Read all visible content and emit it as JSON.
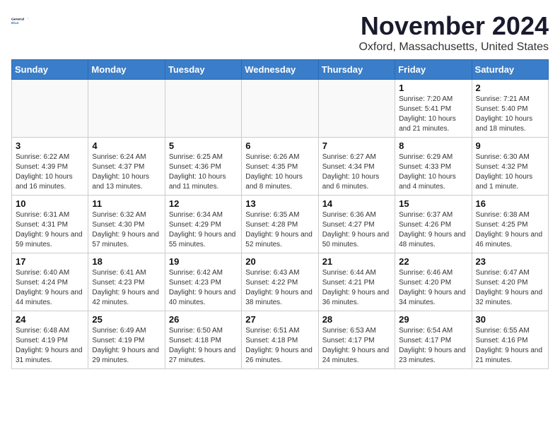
{
  "header": {
    "logo_line1": "General",
    "logo_line2": "Blue",
    "title": "November 2024",
    "subtitle": "Oxford, Massachusetts, United States"
  },
  "weekdays": [
    "Sunday",
    "Monday",
    "Tuesday",
    "Wednesday",
    "Thursday",
    "Friday",
    "Saturday"
  ],
  "weeks": [
    [
      {
        "day": "",
        "empty": true
      },
      {
        "day": "",
        "empty": true
      },
      {
        "day": "",
        "empty": true
      },
      {
        "day": "",
        "empty": true
      },
      {
        "day": "",
        "empty": true
      },
      {
        "day": "1",
        "sunrise": "Sunrise: 7:20 AM",
        "sunset": "Sunset: 5:41 PM",
        "daylight": "Daylight: 10 hours and 21 minutes."
      },
      {
        "day": "2",
        "sunrise": "Sunrise: 7:21 AM",
        "sunset": "Sunset: 5:40 PM",
        "daylight": "Daylight: 10 hours and 18 minutes."
      }
    ],
    [
      {
        "day": "3",
        "sunrise": "Sunrise: 6:22 AM",
        "sunset": "Sunset: 4:39 PM",
        "daylight": "Daylight: 10 hours and 16 minutes."
      },
      {
        "day": "4",
        "sunrise": "Sunrise: 6:24 AM",
        "sunset": "Sunset: 4:37 PM",
        "daylight": "Daylight: 10 hours and 13 minutes."
      },
      {
        "day": "5",
        "sunrise": "Sunrise: 6:25 AM",
        "sunset": "Sunset: 4:36 PM",
        "daylight": "Daylight: 10 hours and 11 minutes."
      },
      {
        "day": "6",
        "sunrise": "Sunrise: 6:26 AM",
        "sunset": "Sunset: 4:35 PM",
        "daylight": "Daylight: 10 hours and 8 minutes."
      },
      {
        "day": "7",
        "sunrise": "Sunrise: 6:27 AM",
        "sunset": "Sunset: 4:34 PM",
        "daylight": "Daylight: 10 hours and 6 minutes."
      },
      {
        "day": "8",
        "sunrise": "Sunrise: 6:29 AM",
        "sunset": "Sunset: 4:33 PM",
        "daylight": "Daylight: 10 hours and 4 minutes."
      },
      {
        "day": "9",
        "sunrise": "Sunrise: 6:30 AM",
        "sunset": "Sunset: 4:32 PM",
        "daylight": "Daylight: 10 hours and 1 minute."
      }
    ],
    [
      {
        "day": "10",
        "sunrise": "Sunrise: 6:31 AM",
        "sunset": "Sunset: 4:31 PM",
        "daylight": "Daylight: 9 hours and 59 minutes."
      },
      {
        "day": "11",
        "sunrise": "Sunrise: 6:32 AM",
        "sunset": "Sunset: 4:30 PM",
        "daylight": "Daylight: 9 hours and 57 minutes."
      },
      {
        "day": "12",
        "sunrise": "Sunrise: 6:34 AM",
        "sunset": "Sunset: 4:29 PM",
        "daylight": "Daylight: 9 hours and 55 minutes."
      },
      {
        "day": "13",
        "sunrise": "Sunrise: 6:35 AM",
        "sunset": "Sunset: 4:28 PM",
        "daylight": "Daylight: 9 hours and 52 minutes."
      },
      {
        "day": "14",
        "sunrise": "Sunrise: 6:36 AM",
        "sunset": "Sunset: 4:27 PM",
        "daylight": "Daylight: 9 hours and 50 minutes."
      },
      {
        "day": "15",
        "sunrise": "Sunrise: 6:37 AM",
        "sunset": "Sunset: 4:26 PM",
        "daylight": "Daylight: 9 hours and 48 minutes."
      },
      {
        "day": "16",
        "sunrise": "Sunrise: 6:38 AM",
        "sunset": "Sunset: 4:25 PM",
        "daylight": "Daylight: 9 hours and 46 minutes."
      }
    ],
    [
      {
        "day": "17",
        "sunrise": "Sunrise: 6:40 AM",
        "sunset": "Sunset: 4:24 PM",
        "daylight": "Daylight: 9 hours and 44 minutes."
      },
      {
        "day": "18",
        "sunrise": "Sunrise: 6:41 AM",
        "sunset": "Sunset: 4:23 PM",
        "daylight": "Daylight: 9 hours and 42 minutes."
      },
      {
        "day": "19",
        "sunrise": "Sunrise: 6:42 AM",
        "sunset": "Sunset: 4:23 PM",
        "daylight": "Daylight: 9 hours and 40 minutes."
      },
      {
        "day": "20",
        "sunrise": "Sunrise: 6:43 AM",
        "sunset": "Sunset: 4:22 PM",
        "daylight": "Daylight: 9 hours and 38 minutes."
      },
      {
        "day": "21",
        "sunrise": "Sunrise: 6:44 AM",
        "sunset": "Sunset: 4:21 PM",
        "daylight": "Daylight: 9 hours and 36 minutes."
      },
      {
        "day": "22",
        "sunrise": "Sunrise: 6:46 AM",
        "sunset": "Sunset: 4:20 PM",
        "daylight": "Daylight: 9 hours and 34 minutes."
      },
      {
        "day": "23",
        "sunrise": "Sunrise: 6:47 AM",
        "sunset": "Sunset: 4:20 PM",
        "daylight": "Daylight: 9 hours and 32 minutes."
      }
    ],
    [
      {
        "day": "24",
        "sunrise": "Sunrise: 6:48 AM",
        "sunset": "Sunset: 4:19 PM",
        "daylight": "Daylight: 9 hours and 31 minutes."
      },
      {
        "day": "25",
        "sunrise": "Sunrise: 6:49 AM",
        "sunset": "Sunset: 4:19 PM",
        "daylight": "Daylight: 9 hours and 29 minutes."
      },
      {
        "day": "26",
        "sunrise": "Sunrise: 6:50 AM",
        "sunset": "Sunset: 4:18 PM",
        "daylight": "Daylight: 9 hours and 27 minutes."
      },
      {
        "day": "27",
        "sunrise": "Sunrise: 6:51 AM",
        "sunset": "Sunset: 4:18 PM",
        "daylight": "Daylight: 9 hours and 26 minutes."
      },
      {
        "day": "28",
        "sunrise": "Sunrise: 6:53 AM",
        "sunset": "Sunset: 4:17 PM",
        "daylight": "Daylight: 9 hours and 24 minutes."
      },
      {
        "day": "29",
        "sunrise": "Sunrise: 6:54 AM",
        "sunset": "Sunset: 4:17 PM",
        "daylight": "Daylight: 9 hours and 23 minutes."
      },
      {
        "day": "30",
        "sunrise": "Sunrise: 6:55 AM",
        "sunset": "Sunset: 4:16 PM",
        "daylight": "Daylight: 9 hours and 21 minutes."
      }
    ]
  ]
}
